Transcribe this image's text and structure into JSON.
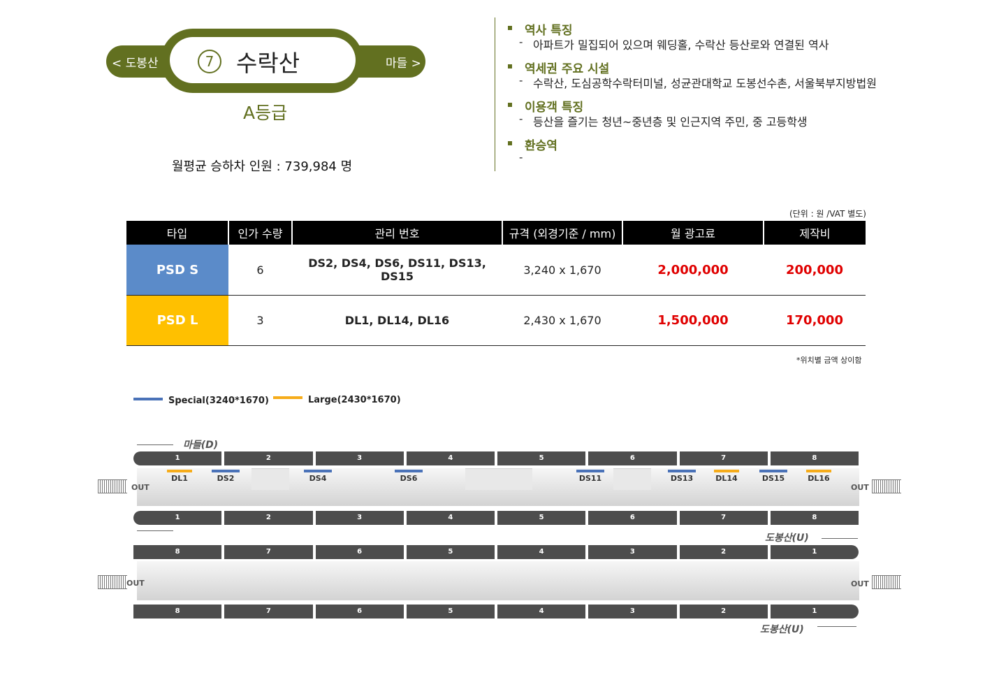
{
  "station": {
    "prev_label": "< 도봉산",
    "next_label": "마들 >",
    "number": "7",
    "name": "수락산",
    "grade": "A등급",
    "ridership": "월평균 승하차 인원 : 739,984 명"
  },
  "info": [
    {
      "title": "역사 특징",
      "text": "아파트가 밀집되어 있으며 웨딩홀, 수락산 등산로와 연결된 역사"
    },
    {
      "title": "역세권 주요 시설",
      "text": "수락산, 도심공학수락터미널, 성균관대학교 도봉선수촌, 서울북부지방법원"
    },
    {
      "title": "이용객 특징",
      "text": "등산을 즐기는 청년~중년층 및 인근지역 주민, 중 고등학생"
    },
    {
      "title": "환승역",
      "text": ""
    }
  ],
  "unit_note": "(단위 : 원 /VAT 별도)",
  "table": {
    "headers": [
      "타입",
      "인가 수량",
      "관리 번호",
      "규격 (외경기준 / mm)",
      "월 광고료",
      "제작비"
    ],
    "rows": [
      {
        "type": "PSD S",
        "qty": "6",
        "ids": "DS2, DS4, DS6, DS11, DS13, DS15",
        "size": "3,240 x 1,670",
        "monthly": "2,000,000",
        "production": "200,000",
        "color": "#5b8bc9"
      },
      {
        "type": "PSD L",
        "qty": "3",
        "ids": "DL1, DL14, DL16",
        "size": "2,430 x 1,670",
        "monthly": "1,500,000",
        "production": "170,000",
        "color": "#ffc000"
      }
    ]
  },
  "price_note": "*위치별 금액 상이함",
  "legend": [
    {
      "label": "Special(3240*1670)",
      "color": "#4a72b8"
    },
    {
      "label": "Large(2430*1670)",
      "color": "#f6ac1a"
    }
  ],
  "diagram": {
    "dir_top": "마들(D)",
    "dir_bottom": "도봉산(U)",
    "out_label": "OUT",
    "cars_forward": [
      "1",
      "2",
      "3",
      "4",
      "5",
      "6",
      "7",
      "8"
    ],
    "cars_reverse": [
      "8",
      "7",
      "6",
      "5",
      "4",
      "3",
      "2",
      "1"
    ],
    "screens": [
      "DL1",
      "DS2",
      "DS4",
      "DS6",
      "DS11",
      "DS13",
      "DL14",
      "DS15",
      "DL16"
    ]
  }
}
